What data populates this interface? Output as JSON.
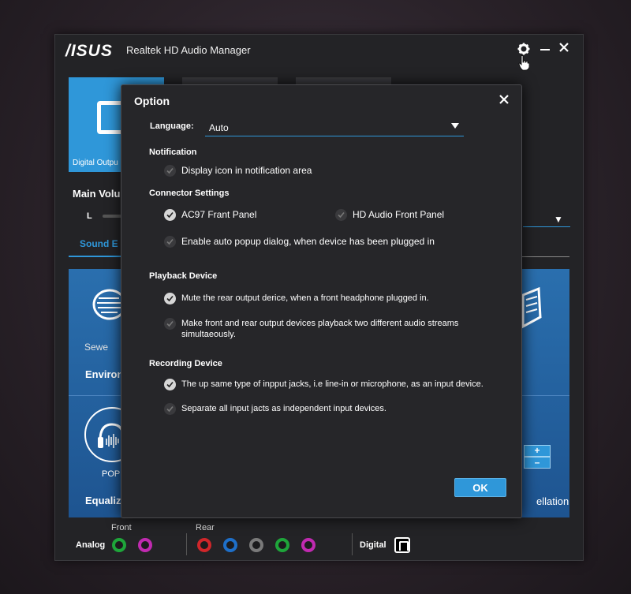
{
  "window": {
    "logo": "/ISUS",
    "title": "Realtek HD Audio Manager",
    "settings_icon": "gear-icon",
    "minimize_icon": "minimize-icon",
    "close_icon": "close-icon"
  },
  "background": {
    "tab_digital_label": "Digital Outpu",
    "main_volume_label": "Main Volu",
    "channel_left": "L",
    "sound_effects_tab": "Sound E",
    "environment_preset": "Sewe",
    "environment_label": "Environ",
    "equalizer_preset": "POP",
    "equalizer_label": "Equaliz",
    "right_panel_label": "ellation",
    "plus": "+",
    "minus": "–"
  },
  "jacks": {
    "front_label": "Front",
    "rear_label": "Rear",
    "analog_label": "Analog",
    "digital_label": "Digital",
    "front": [
      {
        "color": "#1ea53a"
      },
      {
        "color": "#c02ab0"
      }
    ],
    "rear": [
      {
        "color": "#d0262a"
      },
      {
        "color": "#1e6fc8"
      },
      {
        "color": "#7a7a7a"
      },
      {
        "color": "#1ea53a"
      },
      {
        "color": "#c02ab0"
      }
    ]
  },
  "dialog": {
    "title": "Option",
    "language": {
      "label": "Language:",
      "value": "Auto"
    },
    "notification": {
      "heading": "Notification",
      "display_icon": {
        "label": "Display icon in notification area",
        "checked": false
      }
    },
    "connector": {
      "heading": "Connector Settings",
      "ac97": {
        "label": "AC97 Frant Panel",
        "checked": true
      },
      "hd_audio": {
        "label": "HD Audio Front Panel",
        "checked": false
      },
      "auto_popup": {
        "label": "Enable auto popup dialog, when device has been plugged in",
        "checked": false
      }
    },
    "playback": {
      "heading": "Playback Device",
      "mute_rear": {
        "label": "Mute the rear output derice, when a front headphone plugged in.",
        "checked": true
      },
      "two_streams": {
        "label": "Make front and rear output devices playback two different audio streams simultaeously.",
        "checked": false
      }
    },
    "recording": {
      "heading": "Recording Device",
      "same_type": {
        "label": "The up same type of inpput jacks, i.e line-in or microphone, as an input device.",
        "checked": true
      },
      "separate": {
        "label": "Separate all input jacts as independent input devices.",
        "checked": false
      }
    },
    "ok_label": "OK"
  },
  "colors": {
    "accent": "#2f97d9",
    "dialog_bg": "#262629",
    "window_bg": "#232326"
  }
}
